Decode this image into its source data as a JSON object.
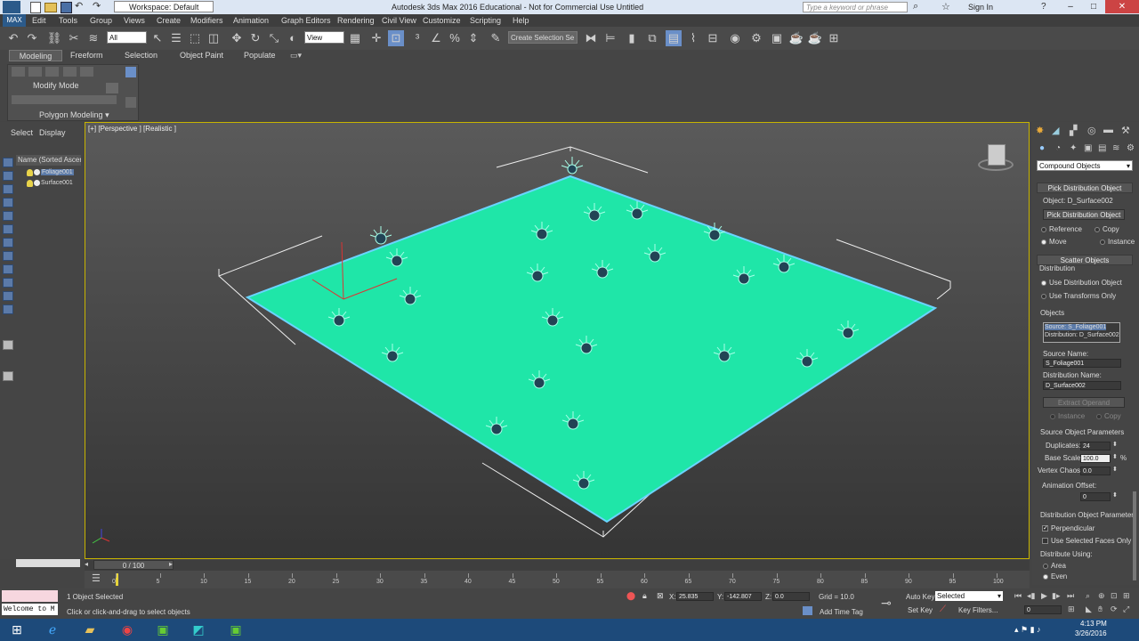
{
  "window": {
    "title": "Autodesk 3ds Max 2016 Educational - Not for Commercial Use    Untitled",
    "workspace": "Workspace: Default",
    "search_placeholder": "Type a keyword or phrase",
    "sign_in": "Sign In"
  },
  "menu": [
    "Edit",
    "Tools",
    "Group",
    "Views",
    "Create",
    "Modifiers",
    "Animation",
    "Graph Editors",
    "Rendering",
    "Civil View",
    "Customize",
    "Scripting",
    "Help"
  ],
  "toolbar": {
    "selection_filter": "All",
    "reference_coord": "View",
    "named_selection": "Create Selection Se"
  },
  "ribbon": {
    "tabs": [
      "Modeling",
      "Freeform",
      "Selection",
      "Object Paint",
      "Populate"
    ],
    "mode": "Modify Mode",
    "panel": "Polygon Modeling"
  },
  "explorer": {
    "tabs": [
      "Select",
      "Display"
    ],
    "column_header": "Name (Sorted Ascendi",
    "items": [
      "Foliage001",
      "Surface001"
    ]
  },
  "viewport": {
    "label": "[+] [Perspective ] [Realistic ]"
  },
  "command_panel": {
    "category": "Compound Objects",
    "pick_rollout": "Pick Distribution Object",
    "object_label": "Object: D_Surface002",
    "pick_button": "Pick Distribution Object",
    "radio_reference": "Reference",
    "radio_copy": "Copy",
    "radio_move": "Move",
    "radio_instance": "Instance",
    "scatter_rollout": "Scatter Objects",
    "distribution_label": "Distribution",
    "use_distribution_object": "Use Distribution Object",
    "use_transforms_only": "Use Transforms Only",
    "objects_label": "Objects",
    "objects_list": [
      "Source: S_Foliage001",
      "Distribution: D_Surface002"
    ],
    "source_name_label": "Source Name:",
    "source_name": "S_Foliage001",
    "distribution_name_label": "Distribution Name:",
    "distribution_name": "D_Surface002",
    "extract_operand": "Extract Operand",
    "extract_instance": "Instance",
    "extract_copy": "Copy",
    "source_params_label": "Source Object Parameters",
    "duplicates_label": "Duplicates:",
    "duplicates": "24",
    "base_scale_label": "Base Scale:",
    "base_scale": "100.0",
    "percent": "%",
    "vertex_chaos_label": "Vertex Chaos:",
    "vertex_chaos": "0.0",
    "animation_offset_label": "Animation Offset:",
    "animation_offset": "0",
    "dist_params_label": "Distribution Object Parameter",
    "perpendicular": "Perpendicular",
    "use_selected_faces": "Use Selected Faces Only",
    "distribute_using": "Distribute Using:",
    "dist_area": "Area",
    "dist_even": "Even"
  },
  "timeline": {
    "frame": "0 / 100",
    "ticks": [
      "0",
      "5",
      "10",
      "15",
      "20",
      "25",
      "30",
      "35",
      "40",
      "45",
      "50",
      "55",
      "60",
      "65",
      "70",
      "75",
      "80",
      "85",
      "90",
      "95",
      "100"
    ]
  },
  "status": {
    "maxscript": "Welcome to M",
    "selected": "1 Object Selected",
    "prompt": "Click or click-and-drag to select objects",
    "x_label": "X:",
    "x": "25.835",
    "y_label": "Y:",
    "y": "-142.807",
    "z_label": "Z:",
    "z": "0.0",
    "grid": "Grid = 10.0",
    "add_time_tag": "Add Time Tag",
    "auto_key": "Auto Key",
    "selected_mode": "Selected",
    "set_key": "Set Key",
    "key_filters": "Key Filters...",
    "frame_field": "0"
  },
  "clock": {
    "time": "4:13 PM",
    "date": "3/26/2016"
  }
}
